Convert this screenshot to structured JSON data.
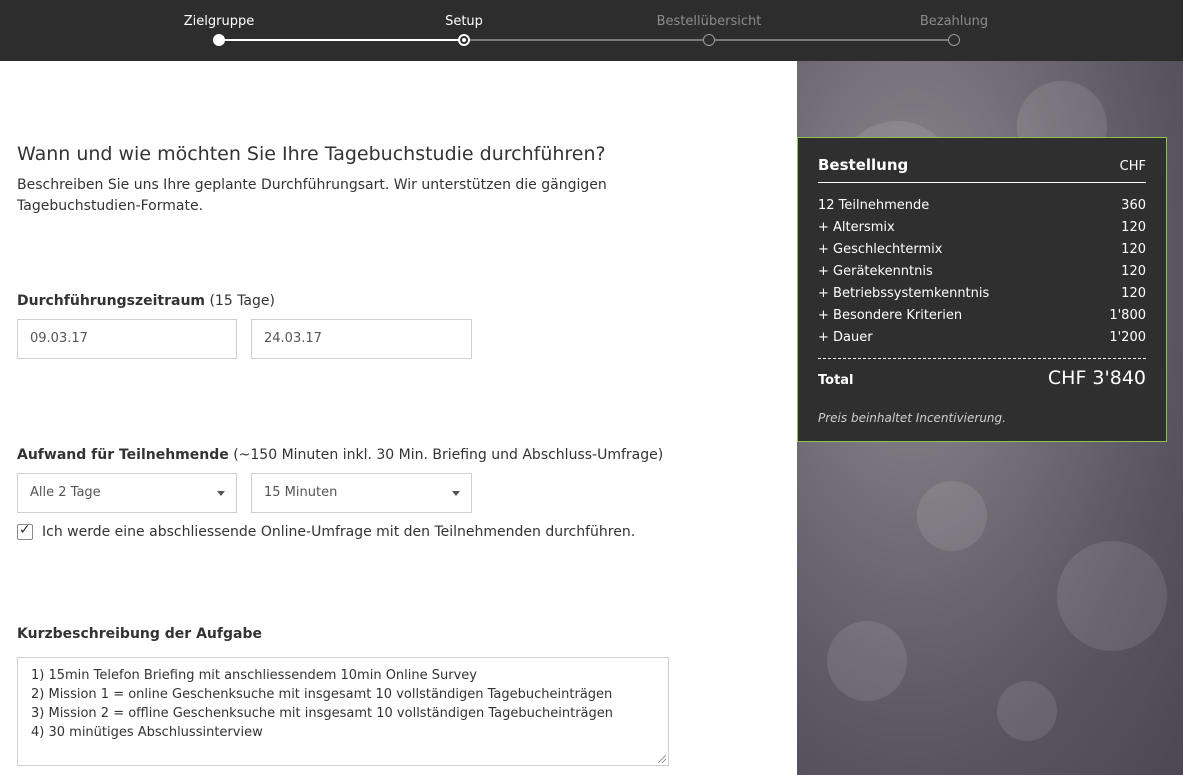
{
  "stepper": {
    "steps": [
      {
        "label": "Zielgruppe",
        "state": "done"
      },
      {
        "label": "Setup",
        "state": "current"
      },
      {
        "label": "Bestellübersicht",
        "state": "todo"
      },
      {
        "label": "Bezahlung",
        "state": "todo"
      }
    ]
  },
  "intro": {
    "heading": "Wann und wie möchten Sie Ihre Tagebuchstudie durchführen?",
    "description": "Beschreiben Sie uns Ihre geplante Durchführungsart. Wir unterstützen die gängigen Tagebuchstudien-Formate."
  },
  "period": {
    "label": "Durchführungszeitraum",
    "label_extra": "(15 Tage)",
    "start_date": "09.03.17",
    "end_date": "24.03.17"
  },
  "effort": {
    "label": "Aufwand für Teilnehmende",
    "label_extra": "(~150 Minuten inkl. 30 Min. Briefing und Abschluss-Umfrage)",
    "frequency_selected": "Alle 2 Tage",
    "duration_selected": "15 Minuten",
    "survey_checkbox_label": "Ich werde eine abschliessende Online-Umfrage mit den Teilnehmenden durchführen.",
    "survey_checked": true
  },
  "task": {
    "label": "Kurzbeschreibung der Aufgabe",
    "lines": [
      "1) 15min Telefon Briefing mit anschliessendem 10min Online Survey",
      "2) Mission 1 = online Geschenksuche mit insgesamt 10 vollständigen Tagebucheinträgen",
      "3) Mission 2 = offline Geschenksuche mit insgesamt 10 vollständigen Tagebucheinträgen",
      "4) 30 minütiges Abschlussinterview"
    ]
  },
  "order": {
    "title": "Bestellung",
    "currency": "CHF",
    "items": [
      {
        "label": "12 Teilnehmende",
        "value": "360"
      },
      {
        "label": "+ Altersmix",
        "value": "120"
      },
      {
        "label": "+ Geschlechtermix",
        "value": "120"
      },
      {
        "label": "+ Gerätekenntnis",
        "value": "120"
      },
      {
        "label": "+ Betriebssystemkenntnis",
        "value": "120"
      },
      {
        "label": "+ Besondere Kriterien",
        "value": "1'800"
      },
      {
        "label": "+ Dauer",
        "value": "1'200"
      }
    ],
    "total_label": "Total",
    "total_value": "CHF 3'840",
    "note": "Preis beinhaltet Incentivierung."
  },
  "colors": {
    "topbar": "#2d2d2d",
    "order_border": "#8bc34a",
    "order_bg": "#2f2f2f"
  }
}
